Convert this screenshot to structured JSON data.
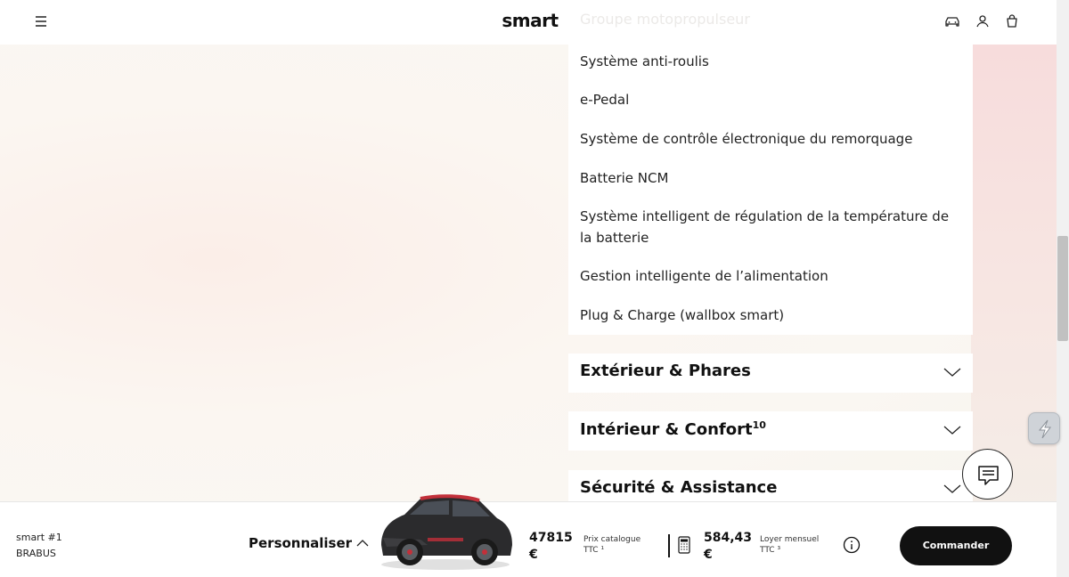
{
  "header": {
    "logo": "smart",
    "faded_heading": "Groupe motopropulseur"
  },
  "features": [
    "Système anti-roulis",
    "e-Pedal",
    "Système de contrôle électronique du remorquage",
    "Batterie NCM",
    "Système intelligent de régulation de la température de la batterie",
    "Gestion intelligente de l’alimentation",
    "Plug & Charge (wallbox smart)"
  ],
  "accordions": [
    {
      "title": "Extérieur & Phares",
      "sup": ""
    },
    {
      "title": "Intérieur & Confort",
      "sup": "10"
    },
    {
      "title": "Sécurité & Assistance",
      "sup": ""
    }
  ],
  "bottom_bar": {
    "model_name": "smart #1",
    "model_variant": "BRABUS",
    "personaliser_label": "Personnaliser",
    "catalog_price": "47815 €",
    "catalog_label": "Prix catalogue TTC ¹",
    "monthly_price": "584,43 €",
    "monthly_label": "Loyer mensuel TTC ³",
    "order_label": "Commander"
  },
  "colors": {
    "accent": "#111111",
    "car_body": "#2b2b2d",
    "car_accent": "#c2303a"
  }
}
